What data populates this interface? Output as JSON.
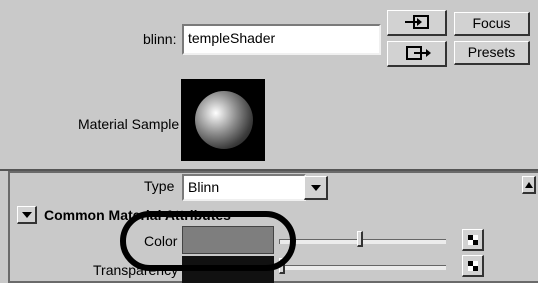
{
  "header": {
    "shader_type_label": "blinn:",
    "shader_name_value": "templeShader",
    "focus_label": "Focus",
    "presets_label": "Presets"
  },
  "material_sample": {
    "label": "Material Sample"
  },
  "attributes": {
    "type_label": "Type",
    "type_value": "Blinn",
    "section_title": "Common Material Attributes",
    "rows": [
      {
        "label": "Color",
        "swatch_color": "#7e7e7e",
        "slider_value": 0.48
      },
      {
        "label": "Transparency",
        "swatch_color": "#111111",
        "slider_value": 0.0
      }
    ]
  },
  "icons": {
    "input_connections": "input-connections-icon",
    "output_connections": "output-connections-icon",
    "map_button": "checker-icon",
    "collapse": "triangle-down-icon",
    "scroll": "triangle-up-icon"
  }
}
